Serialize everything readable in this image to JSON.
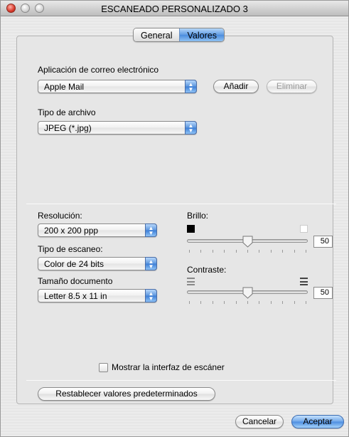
{
  "window": {
    "title": "ESCANEADO PERSONALIZADO 3"
  },
  "tabs": [
    {
      "label": "General",
      "selected": false
    },
    {
      "label": "Valores",
      "selected": true
    }
  ],
  "email": {
    "label": "Aplicación de correo electrónico",
    "value": "Apple Mail",
    "add_button": "Añadir",
    "remove_button": "Eliminar"
  },
  "file_type": {
    "label": "Tipo de archivo",
    "value": "JPEG (*.jpg)"
  },
  "resolution": {
    "label": "Resolución:",
    "value": "200 x 200 ppp"
  },
  "scan_type": {
    "label": "Tipo de escaneo:",
    "value": "Color de 24 bits"
  },
  "doc_size": {
    "label": "Tamaño documento",
    "value": "Letter  8.5 x 11 in"
  },
  "brightness": {
    "label": "Brillo:",
    "value": "50"
  },
  "contrast": {
    "label": "Contraste:",
    "value": "50"
  },
  "show_interface": {
    "label": "Mostrar la interfaz de escáner",
    "checked": false
  },
  "restore_button": "Restablecer valores predeterminados",
  "cancel_button": "Cancelar",
  "ok_button": "Aceptar",
  "colors": {
    "accent": "#4b8ce0"
  }
}
